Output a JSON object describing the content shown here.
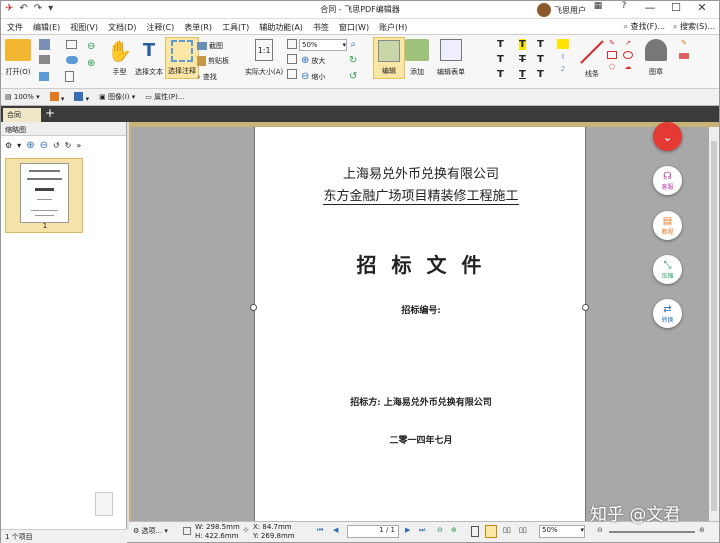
{
  "window": {
    "title": "合同 - 飞思PDF编辑器",
    "user": "飞思用户"
  },
  "menu": [
    "文件",
    "编辑(E)",
    "视图(V)",
    "文档(D)",
    "注释(C)",
    "表单(R)",
    "工具(T)",
    "辅助功能(A)",
    "书签",
    "窗口(W)",
    "账户(H)"
  ],
  "menu_right": {
    "find": "查找(F)...",
    "search": "搜索(S)..."
  },
  "ribbon": {
    "open": "打开(O)",
    "hand": "手型",
    "select_text": "选择文本",
    "select_annot": "选择注释",
    "snapshot": "截图",
    "clipboard": "剪贴板",
    "find": "查找",
    "actual_size": "实际大小(A)",
    "zoom_value": "50%",
    "zoom_in": "放大",
    "zoom_out": "缩小",
    "edit": "编辑",
    "add": "添加",
    "edit_form": "编辑表单",
    "line": "线条",
    "stamp": "图章"
  },
  "toolbar2": {
    "zoom": "100%",
    "image": "图像(I)",
    "properties": "属性(P)..."
  },
  "tab": {
    "label": "合同"
  },
  "left_panel": {
    "title": "缩略图",
    "page_num": "1",
    "status": "1 个项目"
  },
  "document": {
    "line1": "上海易兑外币兑换有限公司",
    "line2": "东方金融广场项目精装修工程施工",
    "title": "招 标 文 件",
    "number_label": "招标编号:",
    "tenderer": "招标方: 上海易兑外币兑换有限公司",
    "date": "二零一四年七月"
  },
  "side_fabs": [
    "客服",
    "教程",
    "压缩",
    "转换"
  ],
  "status": {
    "options": "选项...",
    "w": "W: 298.5mm",
    "h": "H: 422.6mm",
    "x": "X: 84.7mm",
    "y": "Y: 269.8mm",
    "page": "1 / 1",
    "zoom": "50%"
  },
  "watermark": "知乎 @文君",
  "colors": {
    "accent": "#e53935",
    "fab": "#2aa06a",
    "tab": "#f0e6c8",
    "thumb_sel": "#f5e2a8"
  }
}
